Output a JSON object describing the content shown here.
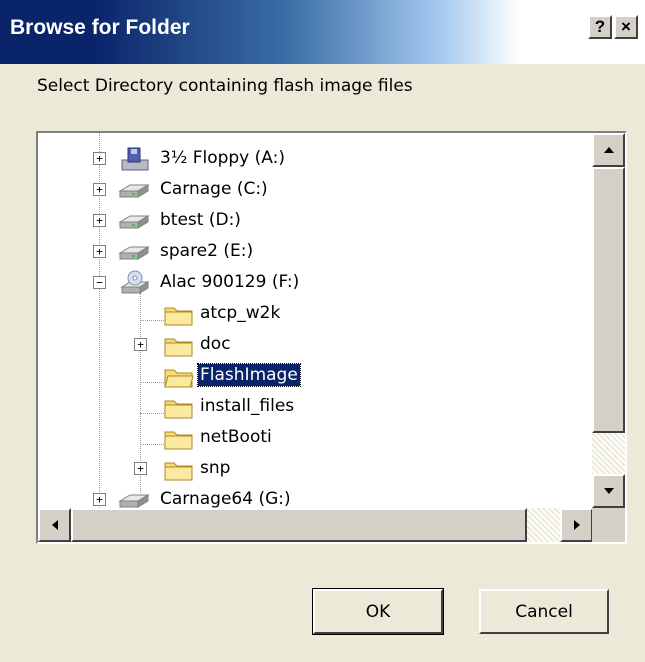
{
  "window": {
    "title": "Browse for Folder",
    "help_label": "?",
    "close_label": "×"
  },
  "prompt": "Select Directory containing flash image files",
  "tree": {
    "items": [
      {
        "label": "3½ Floppy (A:)",
        "icon": "floppy-drive-icon",
        "expander": "+"
      },
      {
        "label": "Carnage (C:)",
        "icon": "hard-drive-icon",
        "expander": "+"
      },
      {
        "label": "btest (D:)",
        "icon": "hard-drive-icon",
        "expander": "+"
      },
      {
        "label": "spare2 (E:)",
        "icon": "hard-drive-icon",
        "expander": "+"
      },
      {
        "label": "Alac 900129 (F:)",
        "icon": "cd-drive-icon",
        "expander": "−"
      },
      {
        "label": "atcp_w2k",
        "icon": "folder-icon",
        "expander": ""
      },
      {
        "label": "doc",
        "icon": "folder-icon",
        "expander": "+"
      },
      {
        "label": "FlashImage",
        "icon": "folder-open-icon",
        "expander": "",
        "selected": true
      },
      {
        "label": "install_files",
        "icon": "folder-icon",
        "expander": ""
      },
      {
        "label": "netBooti",
        "icon": "folder-icon",
        "expander": ""
      },
      {
        "label": "snp",
        "icon": "folder-icon",
        "expander": "+"
      },
      {
        "label": "Carnage64 (G:)",
        "icon": "hard-drive-icon",
        "expander": "+"
      }
    ]
  },
  "buttons": {
    "ok": "OK",
    "cancel": "Cancel"
  },
  "colors": {
    "selection": "#0a246a",
    "dialog_bg": "#ece9d8",
    "title_gradient_start": "#0a246a"
  }
}
